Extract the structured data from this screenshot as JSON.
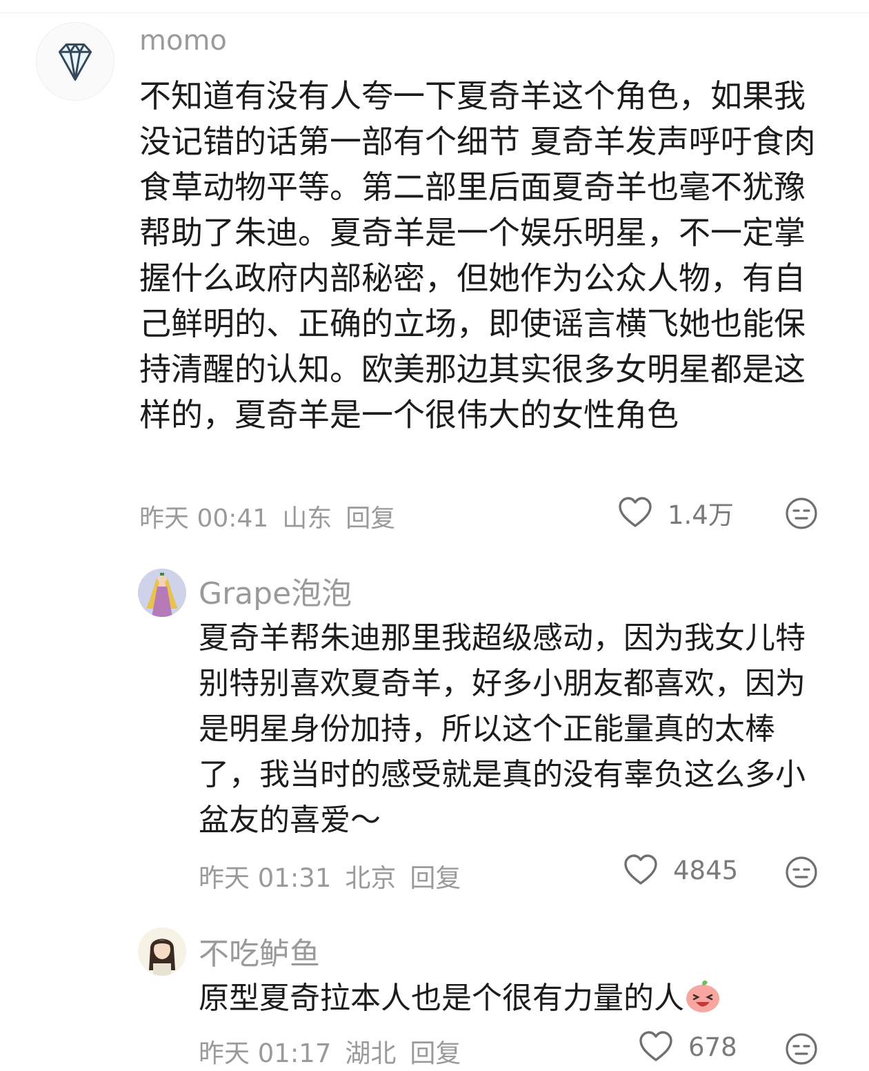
{
  "comments": [
    {
      "username": "momo",
      "avatar_icon": "diamond-icon",
      "content": "不知道有没有人夸一下夏奇羊这个角色，如果我没记错的话第一部有个细节 夏奇羊发声呼吁食肉食草动物平等。第二部里后面夏奇羊也毫不犹豫帮助了朱迪。夏奇羊是一个娱乐明星，不一定掌握什么政府内部秘密，但她作为公众人物，有自己鲜明的、正确的立场，即使谣言横飞她也能保持清醒的认知。欧美那边其实很多女明星都是这样的，夏奇羊是一个很伟大的女性角色",
      "time": "昨天 00:41",
      "location": "山东",
      "reply_label": "回复",
      "likes": "1.4万"
    },
    {
      "username": "Grape泡泡",
      "avatar_icon": "princess-avatar",
      "content": "夏奇羊帮朱迪那里我超级感动，因为我女儿特别特别喜欢夏奇羊，好多小朋友都喜欢，因为是明星身份加持，所以这个正能量真的太棒了，我当时的感受就是真的没有辜负这么多小盆友的喜爱～",
      "time": "昨天 01:31",
      "location": "北京",
      "reply_label": "回复",
      "likes": "4845"
    },
    {
      "username": "不吃鲈鱼",
      "avatar_icon": "girl-avatar",
      "content": "原型夏奇拉本人也是个很有力量的人",
      "content_emoji": "laughing-peach-emoji",
      "time": "昨天 01:17",
      "location": "湖北",
      "reply_label": "回复",
      "likes": "678"
    }
  ],
  "icons": {
    "like": "heart-outline-icon",
    "dislike": "meh-face-icon"
  },
  "colors": {
    "text": "#1c1c1c",
    "muted": "#9a9a9a",
    "icon": "#7a7a7a",
    "emoji": "#f7a7a0"
  }
}
